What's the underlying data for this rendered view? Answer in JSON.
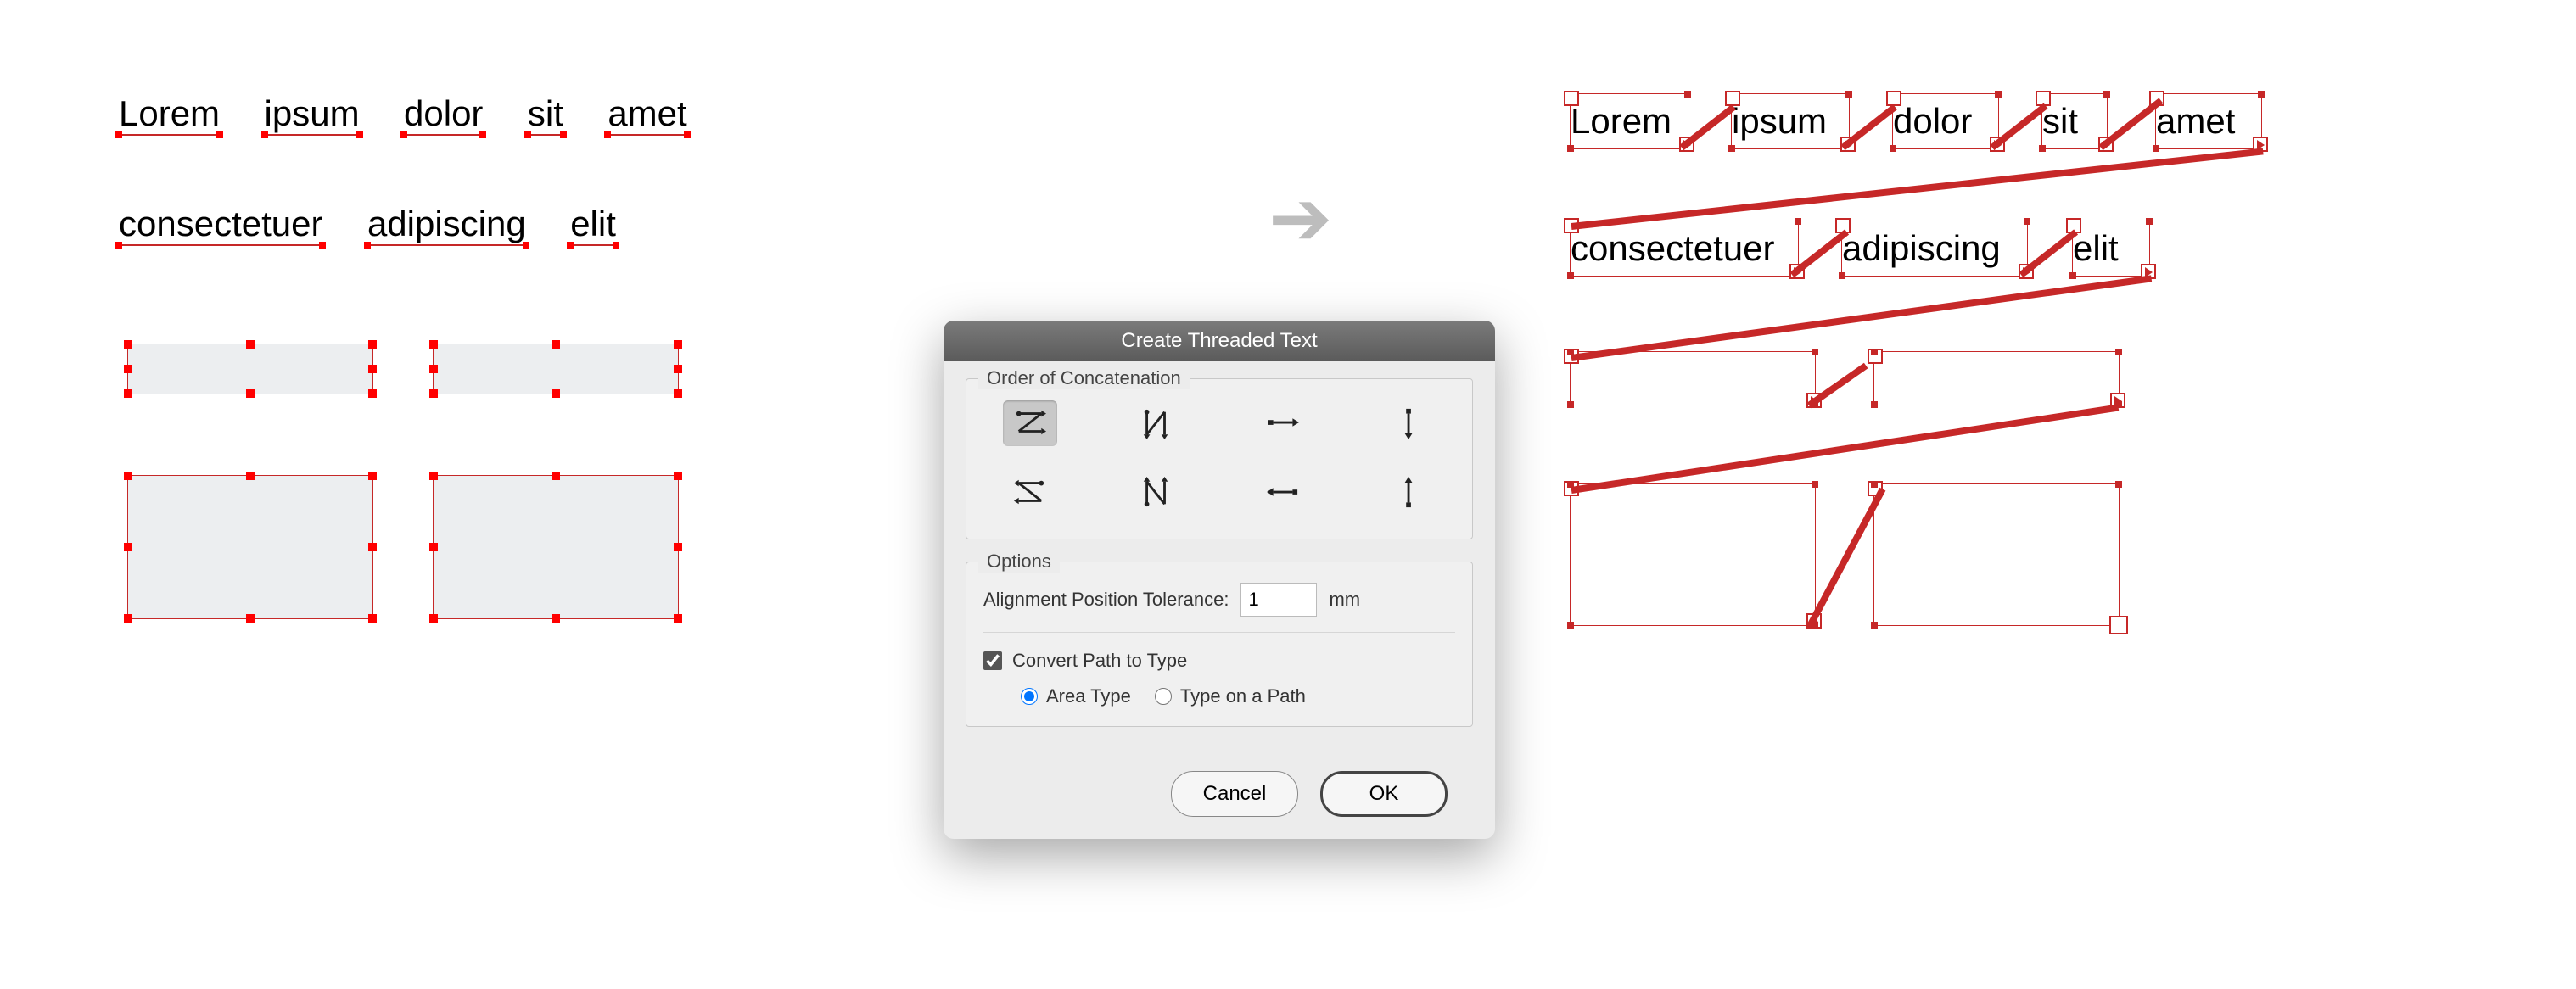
{
  "left": {
    "row1": [
      "Lorem",
      "ipsum",
      "dolor",
      "sit",
      "amet"
    ],
    "row2": [
      "consectetuer",
      "adipiscing",
      "elit"
    ]
  },
  "dialog": {
    "title": "Create Threaded Text",
    "order_legend": "Order of Concatenation",
    "options_legend": "Options",
    "tolerance_label": "Alignment Position Tolerance:",
    "tolerance_value": "1",
    "tolerance_unit": "mm",
    "convert_label": "Convert Path to Type",
    "convert_checked": true,
    "radio_area": "Area Type",
    "radio_path": "Type on a Path",
    "radio_selected": "area",
    "cancel": "Cancel",
    "ok": "OK",
    "selected_order_index": 0
  },
  "right": {
    "row1": [
      "Lorem",
      "ipsum",
      "dolor",
      "sit",
      "amet"
    ],
    "row2": [
      "consectetuer",
      "adipiscing",
      "elit"
    ]
  },
  "arrow": "➡"
}
